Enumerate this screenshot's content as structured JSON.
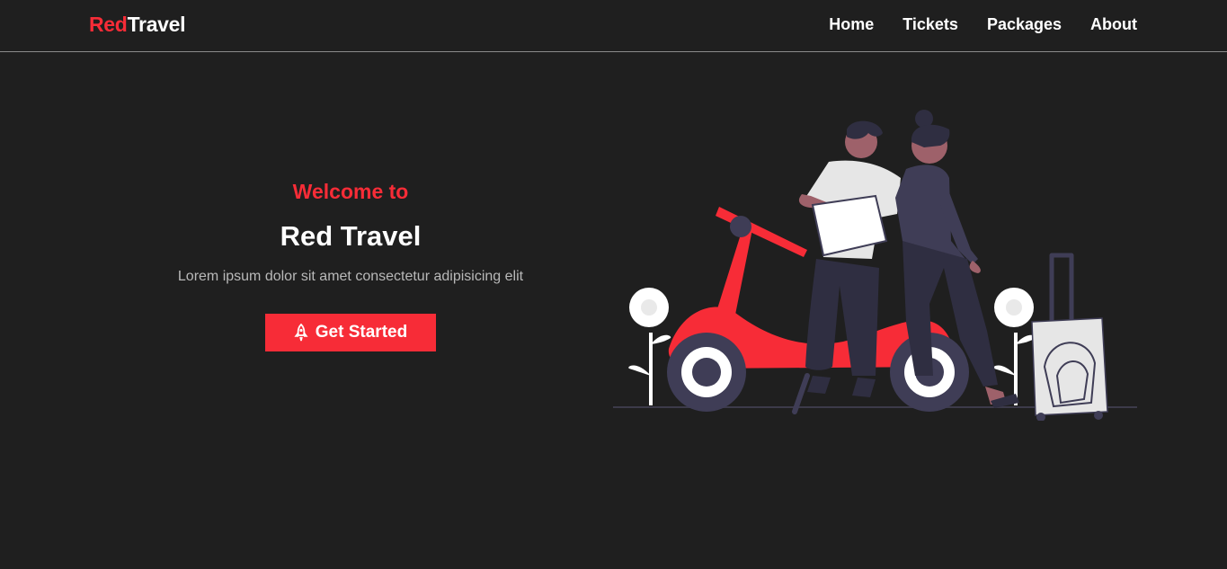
{
  "brand": {
    "part1": "Red",
    "part2": "Travel"
  },
  "nav": {
    "home": "Home",
    "tickets": "Tickets",
    "packages": "Packages",
    "about": "About"
  },
  "hero": {
    "welcome": "Welcome to",
    "title": "Red Travel",
    "subtitle": "Lorem ipsum dolor sit amet consectetur adipisicing elit",
    "cta_label": "Get Started",
    "cta_icon": "rocket-icon"
  },
  "colors": {
    "background": "#1f1f1f",
    "accent": "#f72c37",
    "text": "#ffffff",
    "muted_text": "#b9b9b9"
  }
}
